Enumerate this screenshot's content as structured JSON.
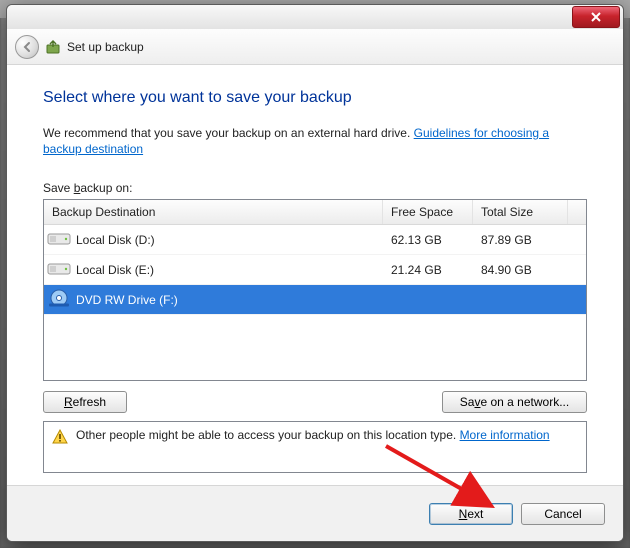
{
  "header": {
    "title": "Set up backup"
  },
  "page": {
    "heading": "Select where you want to save your backup",
    "intro_prefix": "We recommend that you save your backup on an external hard drive. ",
    "intro_link": "Guidelines for choosing a backup destination",
    "list_label_pre": "Save ",
    "list_label_u": "b",
    "list_label_post": "ackup on:"
  },
  "columns": {
    "dest": "Backup Destination",
    "free": "Free Space",
    "total": "Total Size"
  },
  "drives": [
    {
      "name": "Local Disk (D:)",
      "free": "62.13 GB",
      "total": "87.89 GB",
      "type": "hdd",
      "selected": false
    },
    {
      "name": "Local Disk (E:)",
      "free": "21.24 GB",
      "total": "84.90 GB",
      "type": "hdd",
      "selected": false
    },
    {
      "name": "DVD RW Drive (F:)",
      "free": "",
      "total": "",
      "type": "dvd",
      "selected": true
    }
  ],
  "buttons": {
    "refresh_u": "R",
    "refresh_post": "efresh",
    "network_pre": "Sa",
    "network_u": "v",
    "network_post": "e on a network...",
    "next_u": "N",
    "next_post": "ext",
    "cancel": "Cancel"
  },
  "info": {
    "text": "Other people might be able to access your backup on this location type. ",
    "link": "More information"
  }
}
